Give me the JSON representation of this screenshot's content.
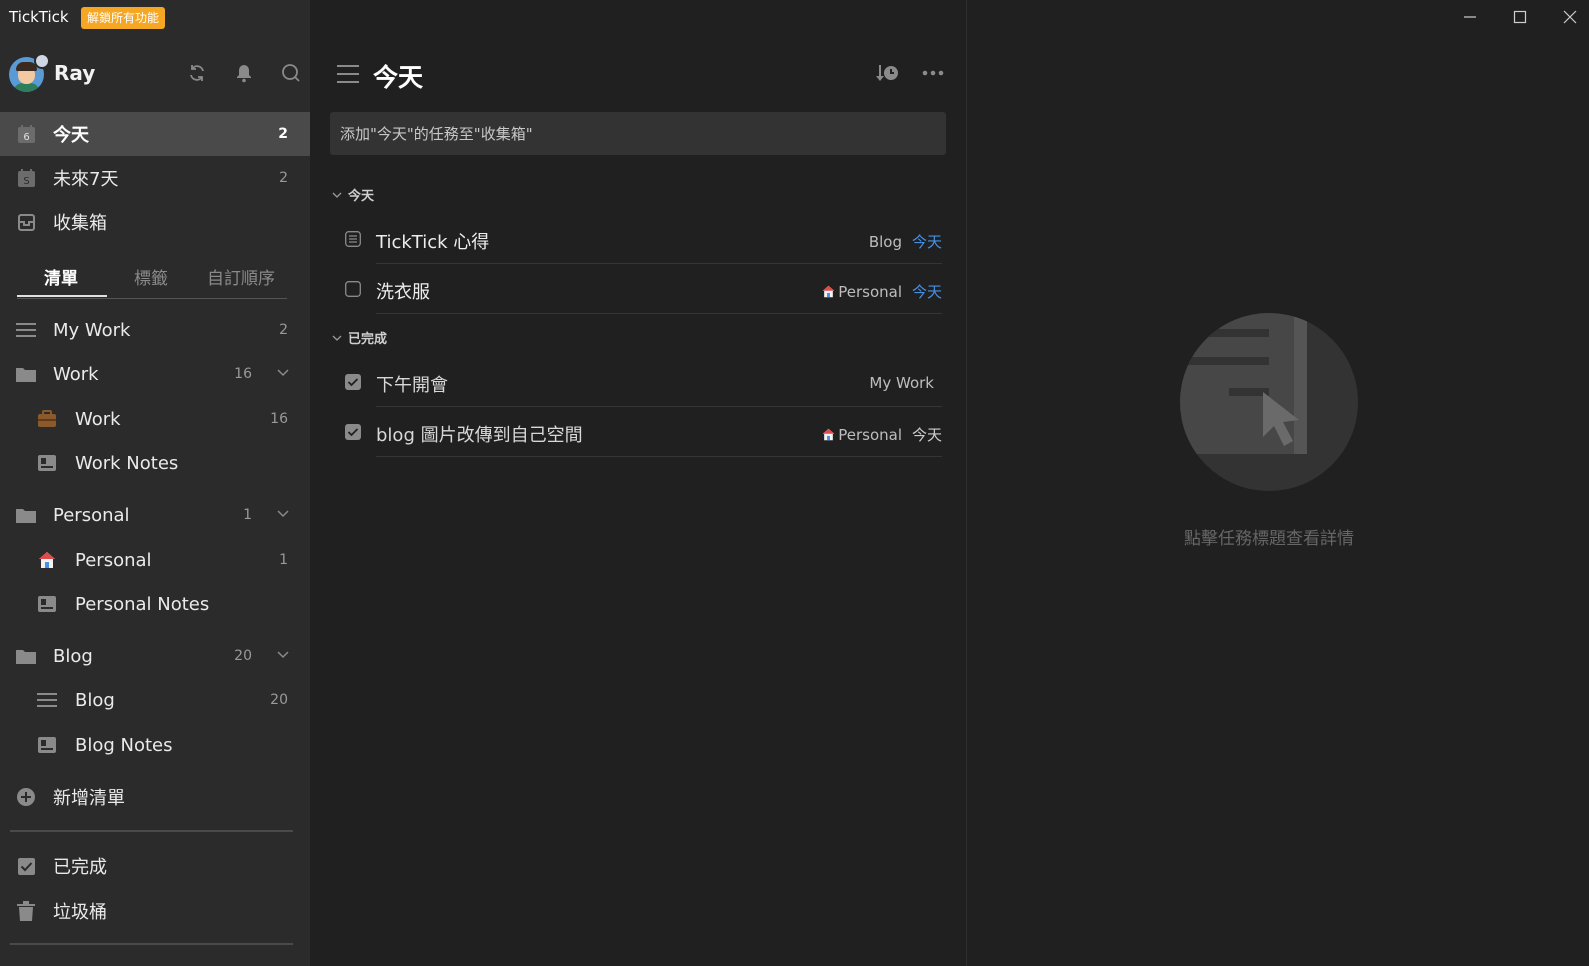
{
  "app": {
    "title": "TickTick",
    "unlock_badge": "解鎖所有功能"
  },
  "user": {
    "name": "Ray"
  },
  "smart_lists": [
    {
      "label": "今天",
      "count": "2",
      "icon": "calendar-today-icon"
    },
    {
      "label": "未來7天",
      "count": "2",
      "icon": "calendar-week-icon"
    },
    {
      "label": "收集箱",
      "count": "",
      "icon": "inbox-icon"
    }
  ],
  "tabs": [
    "清單",
    "標籤",
    "自訂順序"
  ],
  "lists": {
    "my_work": {
      "label": "My Work",
      "count": "2"
    },
    "work_folder": {
      "label": "Work",
      "count": "16"
    },
    "work": {
      "label": "Work",
      "count": "16"
    },
    "work_notes": {
      "label": "Work Notes"
    },
    "personal_folder": {
      "label": "Personal",
      "count": "1"
    },
    "personal": {
      "label": "Personal",
      "count": "1"
    },
    "personal_notes": {
      "label": "Personal Notes"
    },
    "blog_folder": {
      "label": "Blog",
      "count": "20"
    },
    "blog": {
      "label": "Blog",
      "count": "20"
    },
    "blog_notes": {
      "label": "Blog Notes"
    }
  },
  "add_list": "新增清單",
  "bottom": {
    "completed": "已完成",
    "trash": "垃圾桶"
  },
  "main": {
    "title": "今天",
    "add_placeholder": "添加\"今天\"的任務至\"收集箱\"",
    "sections": [
      {
        "title": "今天"
      },
      {
        "title": "已完成"
      }
    ],
    "tasks": [
      {
        "title": "TickTick 心得",
        "list": "Blog",
        "date": "今天"
      },
      {
        "title": "洗衣服",
        "list": "Personal",
        "date": "今天"
      },
      {
        "title": "下午開會",
        "list": "My Work",
        "date": ""
      },
      {
        "title": "blog 圖片改傳到自己空間",
        "list": "Personal",
        "date": "今天"
      }
    ]
  },
  "detail": {
    "empty_hint": "點擊任務標題查看詳情"
  },
  "colors": {
    "accent_blue": "#4a90e2",
    "badge_orange": "#f5a623",
    "sidebar_bg": "#2b2b2b",
    "main_bg": "#202020"
  }
}
